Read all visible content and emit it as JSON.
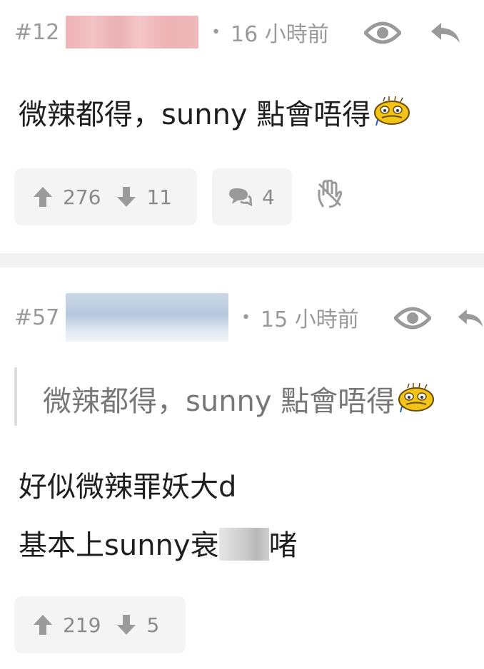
{
  "posts": [
    {
      "floor": "#12",
      "time": "16 小時前",
      "content": "微辣都得，sunny 點會唔得",
      "upvotes": "276",
      "downvotes": "11",
      "replies": "4"
    },
    {
      "floor": "#57",
      "time": "15 小時前",
      "quote": "微辣都得，sunny 點會唔得",
      "lines": [
        "好似微辣罪妖大d",
        "基本上sunny衰",
        "啫"
      ],
      "upvotes": "219",
      "downvotes": "5"
    }
  ],
  "separator": "•",
  "colors": {
    "meta": "#9a9a9a",
    "text": "#1f1f1f",
    "quote": "#777777",
    "box": "#f4f4f4"
  },
  "icons": [
    "eye-icon",
    "reply-icon",
    "thumb-up-icon",
    "thumb-down-icon",
    "comment-icon",
    "hand-icon",
    "emoji-icon"
  ]
}
